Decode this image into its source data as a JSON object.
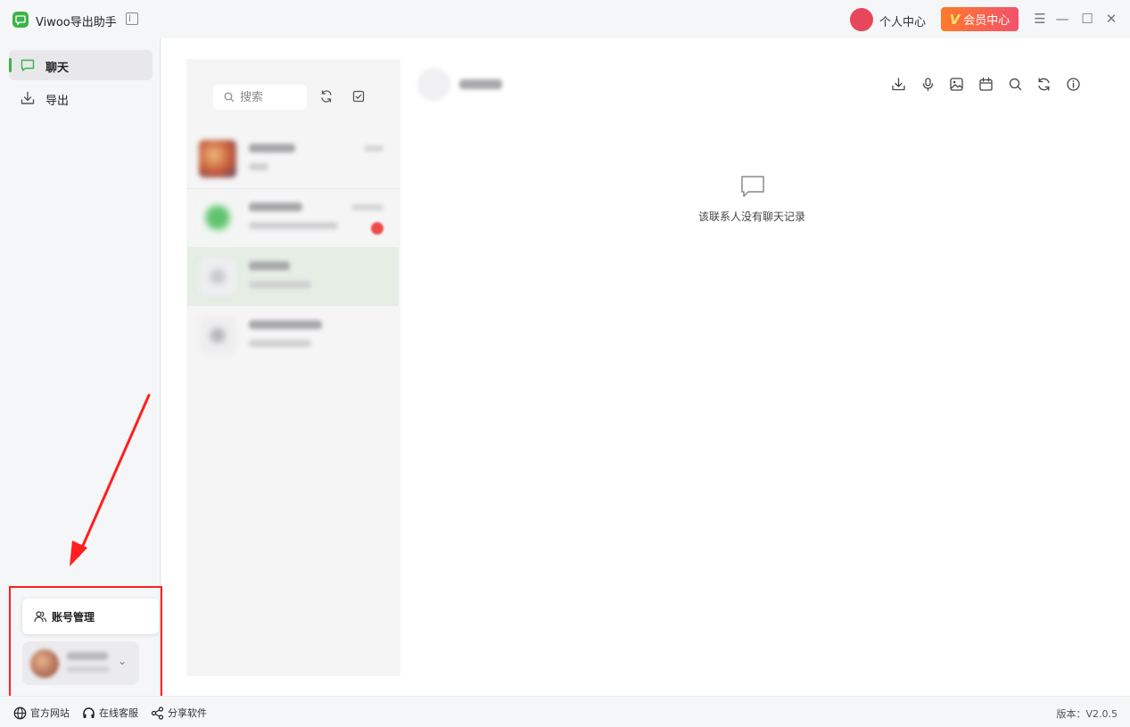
{
  "app": {
    "title": "Viwoo导出助手",
    "personal_center": "个人中心",
    "vip_label": "会员中心",
    "vip_letter": "V"
  },
  "window_controls": [
    "☰",
    "—",
    "☐",
    "✕"
  ],
  "sidebar": {
    "items": [
      {
        "label": "聊天",
        "icon": "chat-bubble-icon",
        "active": true
      },
      {
        "label": "导出",
        "icon": "download-icon",
        "active": false
      }
    ],
    "account_menu": {
      "label": "账号管理",
      "icon": "users-icon"
    }
  },
  "search": {
    "placeholder": "搜索"
  },
  "chat": {
    "empty_text": "该联系人没有聊天记录"
  },
  "footer": {
    "links": [
      {
        "label": "官方网站",
        "icon": "globe-icon"
      },
      {
        "label": "在线客服",
        "icon": "headset-icon"
      },
      {
        "label": "分享软件",
        "icon": "share-icon"
      }
    ],
    "version": "版本：V2.0.5"
  },
  "colors": {
    "accent": "#3cb34a",
    "vip_start": "#ff7a2b",
    "vip_end": "#f4516c",
    "highlight": "#ff1f1f"
  }
}
